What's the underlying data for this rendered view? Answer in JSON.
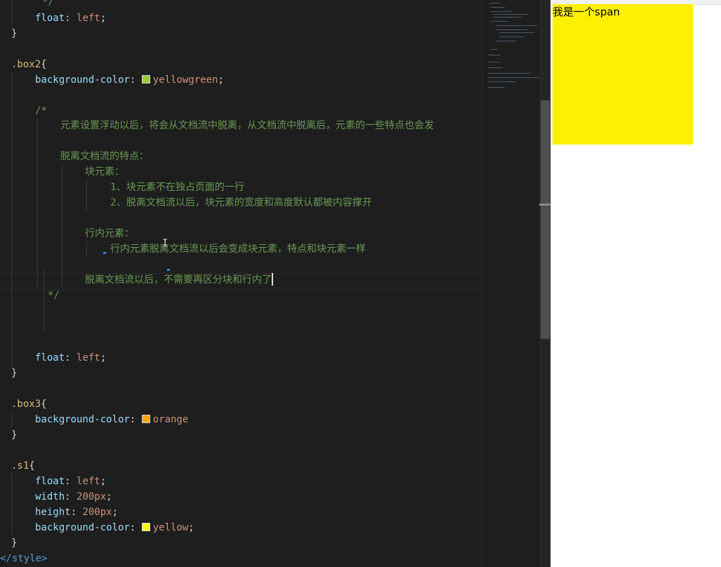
{
  "editor": {
    "code": {
      "l1_prop": "float",
      "l1_val": "left",
      "close1": "}",
      "box2_sel": ".box2",
      "box2_bg_prop": "background-color",
      "box2_bg_val": "yellowgreen",
      "comment_open": "/*",
      "comment_l1": "元素设置浮动以后，将会从文档流中脱离，从文档流中脱离后，元素的一些特点也会发",
      "comment_l2": "脱离文档流的特点：",
      "comment_l3": "块元素：",
      "comment_l4": "1、块元素不在独占页面的一行",
      "comment_l5": "2、脱离文档流以后，块元素的宽度和高度默认都被内容撑开",
      "comment_l6": "行内元素：",
      "comment_l7": "行内元素脱离文档流以后会变成块元素，特点和块元素一样",
      "comment_l8": "脱离文档流以后，不需要再区分块和行内了",
      "comment_close": "*/",
      "box2_float_prop": "float",
      "box2_float_val": "left",
      "close2": "}",
      "box3_sel": ".box3",
      "box3_bg_prop": "background-color",
      "box3_bg_val": "orange",
      "close3": "}",
      "s1_sel": ".s1",
      "s1_float_prop": "float",
      "s1_float_val": "left",
      "s1_width_prop": "width",
      "s1_width_val": "200px",
      "s1_height_prop": "height",
      "s1_height_val": "200px",
      "s1_bg_prop": "background-color",
      "s1_bg_val": "yellow",
      "close4": "}",
      "style_close_tag": "style",
      "top_comment_tail": "*/"
    },
    "swatches": {
      "yellowgreen": "#9acd32",
      "orange": "#ffa500",
      "yellow": "#ffff00"
    }
  },
  "preview": {
    "span_text": "我是一个span",
    "span_color": "#ffef00"
  }
}
